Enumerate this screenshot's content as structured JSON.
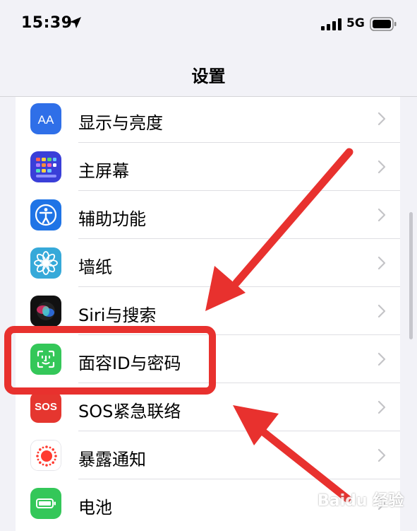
{
  "status_bar": {
    "time": "15:39",
    "network": "5G",
    "icons": [
      "location-arrow-icon",
      "signal-bars-icon",
      "battery-icon"
    ]
  },
  "nav": {
    "title": "设置"
  },
  "settings": [
    {
      "label": "显示与亮度",
      "icon": "display-brightness-icon",
      "color": "#2f6fe8"
    },
    {
      "label": "主屏幕",
      "icon": "home-screen-icon",
      "color": "#3a3fd8"
    },
    {
      "label": "辅助功能",
      "icon": "accessibility-icon",
      "color": "#1f74e6"
    },
    {
      "label": "墙纸",
      "icon": "wallpaper-flower-icon",
      "color": "#36a9d9"
    },
    {
      "label": "Siri与搜索",
      "icon": "siri-icon",
      "color": "#111111"
    },
    {
      "label": "面容ID与密码",
      "icon": "face-id-icon",
      "color": "#34c759"
    },
    {
      "label": "SOS紧急联络",
      "icon": "sos-icon",
      "color": "#e5362f",
      "icon_text": "SOS"
    },
    {
      "label": "暴露通知",
      "icon": "exposure-notification-icon",
      "color": "#ffffff"
    },
    {
      "label": "电池",
      "icon": "battery-settings-icon",
      "color": "#34c759"
    }
  ],
  "annotation": {
    "color": "#e8312e",
    "highlighted_item": "面容ID与密码"
  },
  "watermark": {
    "text": "Baidu 经验"
  }
}
